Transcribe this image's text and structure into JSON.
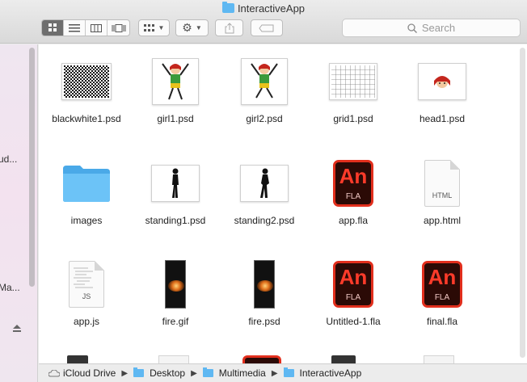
{
  "window": {
    "title": "InteractiveApp",
    "title_icon": "folder-icon"
  },
  "toolbar": {
    "view_modes": [
      "icon-view",
      "list-view",
      "column-view",
      "gallery-view"
    ],
    "active_view": "icon-view",
    "group_icon": "grid-icon",
    "action_icon": "gear-icon",
    "share_icon": "share-icon",
    "tag_icon": "tag-icon",
    "search_placeholder": "Search"
  },
  "sidebar": {
    "visible_fragments": [
      "ud...",
      "Ma..."
    ],
    "eject_icon": "eject-icon"
  },
  "files": [
    {
      "name": "blackwhite1.psd",
      "kind": "psd-checker"
    },
    {
      "name": "girl1.psd",
      "kind": "psd-girl"
    },
    {
      "name": "girl2.psd",
      "kind": "psd-girl"
    },
    {
      "name": "grid1.psd",
      "kind": "psd-grid"
    },
    {
      "name": "head1.psd",
      "kind": "psd-head"
    },
    {
      "name": "images",
      "kind": "folder"
    },
    {
      "name": "standing1.psd",
      "kind": "psd-silhouette"
    },
    {
      "name": "standing2.psd",
      "kind": "psd-silhouette"
    },
    {
      "name": "app.fla",
      "kind": "fla"
    },
    {
      "name": "app.html",
      "kind": "html-doc"
    },
    {
      "name": "app.js",
      "kind": "js-doc"
    },
    {
      "name": "fire.gif",
      "kind": "fire"
    },
    {
      "name": "fire.psd",
      "kind": "fire"
    },
    {
      "name": "Untitled-1.fla",
      "kind": "fla"
    },
    {
      "name": "final.fla",
      "kind": "fla"
    }
  ],
  "icon_text": {
    "an": "An",
    "fla": "FLA",
    "html": "HTML",
    "js": "JS"
  },
  "pathbar": {
    "segments": [
      "iCloud Drive",
      "Desktop",
      "Multimedia",
      "InteractiveApp"
    ],
    "root_icon": "cloud-icon",
    "folder_icon": "folder-icon"
  },
  "colors": {
    "folder": "#5fb8f2",
    "animate_bg": "#2b0a06",
    "animate_accent": "#e22f1d"
  }
}
